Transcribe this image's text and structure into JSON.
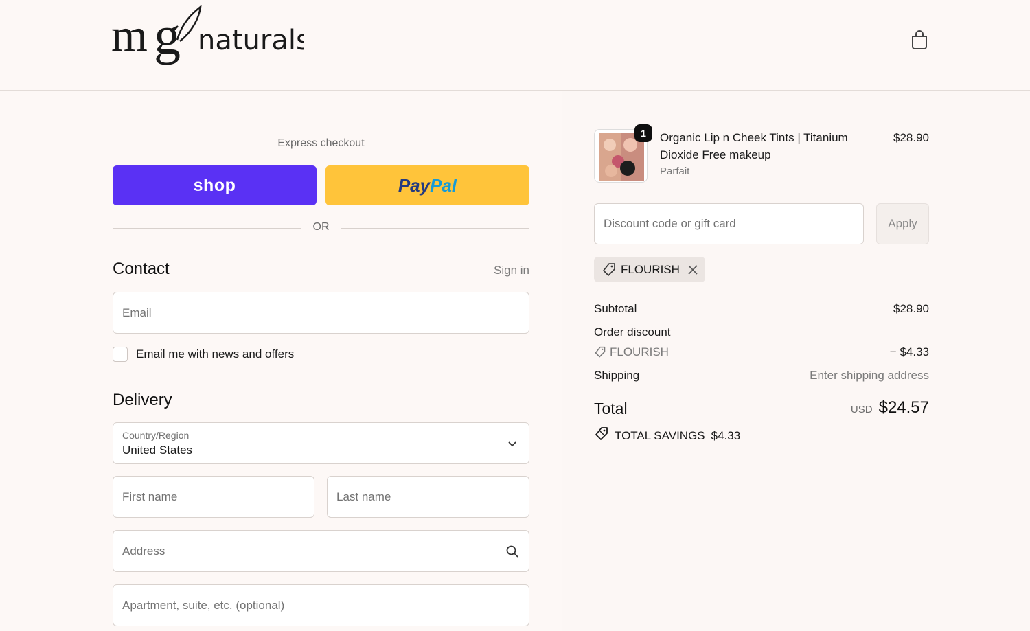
{
  "header": {
    "brand": "mgnaturals",
    "cart_icon": "shopping-bag-icon"
  },
  "express": {
    "label": "Express checkout",
    "shop_label": "shop",
    "paypal_a": "Pay",
    "paypal_b": "Pal",
    "or_text": "OR"
  },
  "contact": {
    "title": "Contact",
    "sign_in": "Sign in",
    "email_placeholder": "Email",
    "newsletter_label": "Email me with news and offers",
    "newsletter_checked": false
  },
  "delivery": {
    "title": "Delivery",
    "country_label": "Country/Region",
    "country_value": "United States",
    "first_name_placeholder": "First name",
    "last_name_placeholder": "Last name",
    "address_placeholder": "Address",
    "apartment_placeholder": "Apartment, suite, etc. (optional)"
  },
  "order": {
    "item": {
      "quantity": "1",
      "title": "Organic Lip n Cheek Tints | Titanium Dioxide Free makeup",
      "variant": "Parfait",
      "price": "$28.90"
    },
    "discount_placeholder": "Discount code or gift card",
    "apply_label": "Apply",
    "applied_code": "FLOURISH",
    "subtotal_label": "Subtotal",
    "subtotal_value": "$28.90",
    "order_discount_label": "Order discount",
    "discount_code": "FLOURISH",
    "discount_value": "− $4.33",
    "shipping_label": "Shipping",
    "shipping_value": "Enter shipping address",
    "total_label": "Total",
    "total_currency": "USD",
    "total_value": "$24.57",
    "savings_label": "TOTAL SAVINGS",
    "savings_value": "$4.33"
  },
  "colors": {
    "shop_purple": "#5a31f4",
    "paypal_yellow": "#ffc43a",
    "page_bg": "#fdf8f6"
  }
}
